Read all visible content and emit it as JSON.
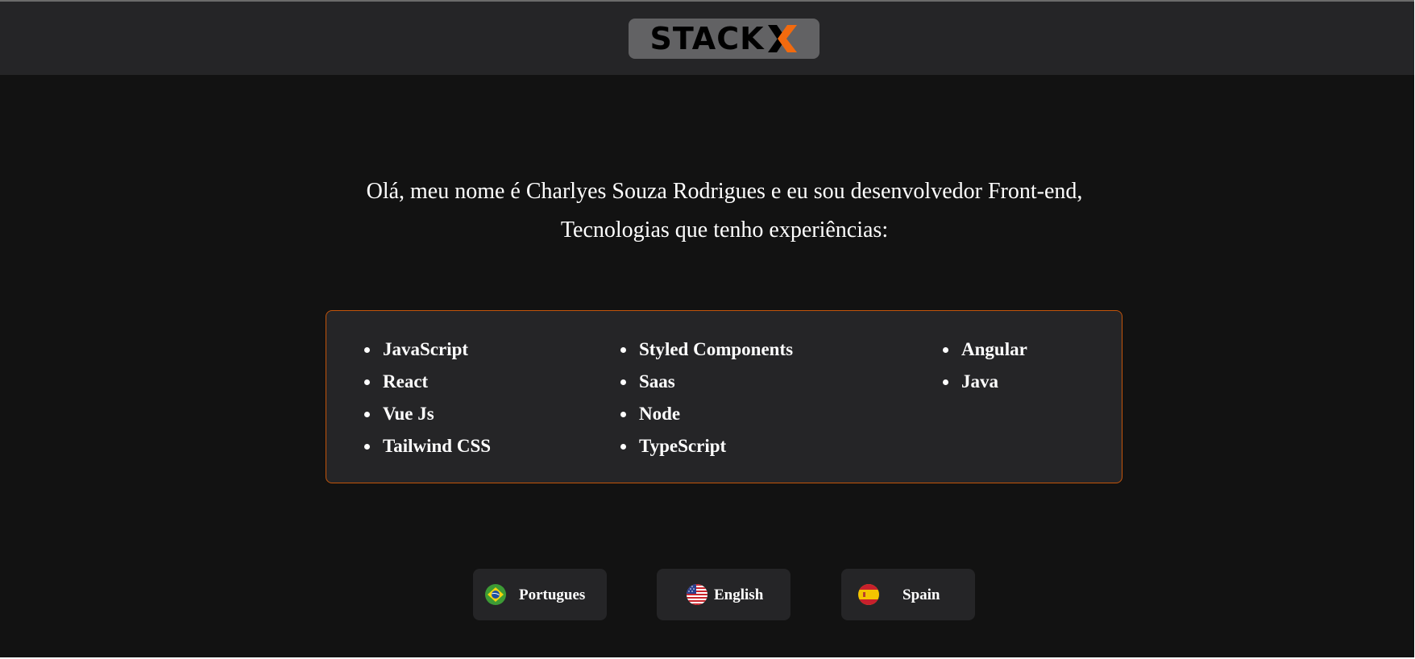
{
  "header": {
    "logo_text": "STACK",
    "logo_accent_color": "#f26a0e"
  },
  "intro": {
    "line1": "Olá, meu nome é Charlyes Souza Rodrigues e eu sou desenvolvedor Front-end,",
    "line2": "Tecnologias que tenho experiências:"
  },
  "technologies": {
    "column1": [
      "JavaScript",
      "React",
      "Vue Js",
      "Tailwind CSS"
    ],
    "column2": [
      "Styled Components",
      "Saas",
      "Node",
      "TypeScript"
    ],
    "column3": [
      "Angular",
      "Java"
    ]
  },
  "languages": [
    {
      "label": "Portugues",
      "flag": "brazil-flag-icon"
    },
    {
      "label": "English",
      "flag": "usa-flag-icon"
    },
    {
      "label": "Spain",
      "flag": "spain-flag-icon"
    }
  ],
  "colors": {
    "page_background": "#121212",
    "header_background": "#252527",
    "card_border": "#c2540a",
    "accent": "#f26a0e"
  }
}
